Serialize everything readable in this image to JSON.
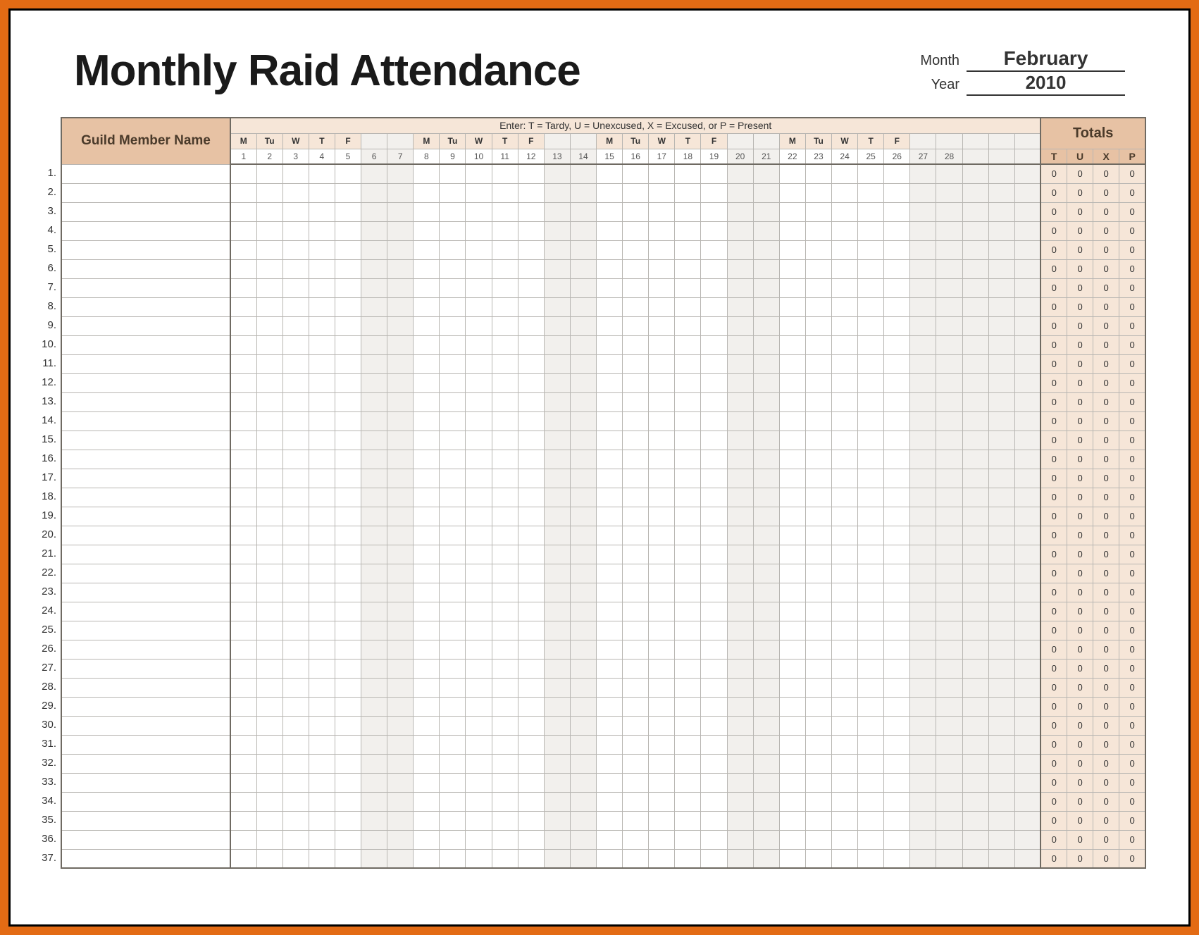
{
  "title": "Monthly Raid Attendance",
  "month_label": "Month",
  "year_label": "Year",
  "month": "February",
  "year": "2010",
  "legend": "Enter: T = Tardy,  U = Unexcused,  X = Excused,  or P = Present",
  "name_header": "Guild Member Name",
  "totals_header": "Totals",
  "total_codes": [
    "T",
    "U",
    "X",
    "P"
  ],
  "num_rows": 37,
  "num_day_columns": 31,
  "days_in_month": 28,
  "days": [
    {
      "n": 1,
      "dow": "M",
      "weekend": false
    },
    {
      "n": 2,
      "dow": "Tu",
      "weekend": false
    },
    {
      "n": 3,
      "dow": "W",
      "weekend": false
    },
    {
      "n": 4,
      "dow": "T",
      "weekend": false
    },
    {
      "n": 5,
      "dow": "F",
      "weekend": false
    },
    {
      "n": 6,
      "dow": "",
      "weekend": true
    },
    {
      "n": 7,
      "dow": "",
      "weekend": true
    },
    {
      "n": 8,
      "dow": "M",
      "weekend": false
    },
    {
      "n": 9,
      "dow": "Tu",
      "weekend": false
    },
    {
      "n": 10,
      "dow": "W",
      "weekend": false
    },
    {
      "n": 11,
      "dow": "T",
      "weekend": false
    },
    {
      "n": 12,
      "dow": "F",
      "weekend": false
    },
    {
      "n": 13,
      "dow": "",
      "weekend": true
    },
    {
      "n": 14,
      "dow": "",
      "weekend": true
    },
    {
      "n": 15,
      "dow": "M",
      "weekend": false
    },
    {
      "n": 16,
      "dow": "Tu",
      "weekend": false
    },
    {
      "n": 17,
      "dow": "W",
      "weekend": false
    },
    {
      "n": 18,
      "dow": "T",
      "weekend": false
    },
    {
      "n": 19,
      "dow": "F",
      "weekend": false
    },
    {
      "n": 20,
      "dow": "",
      "weekend": true
    },
    {
      "n": 21,
      "dow": "",
      "weekend": true
    },
    {
      "n": 22,
      "dow": "M",
      "weekend": false
    },
    {
      "n": 23,
      "dow": "Tu",
      "weekend": false
    },
    {
      "n": 24,
      "dow": "W",
      "weekend": false
    },
    {
      "n": 25,
      "dow": "T",
      "weekend": false
    },
    {
      "n": 26,
      "dow": "F",
      "weekend": false
    },
    {
      "n": 27,
      "dow": "",
      "weekend": true
    },
    {
      "n": 28,
      "dow": "",
      "weekend": true
    }
  ],
  "rows": [
    {
      "name": "",
      "marks": [],
      "totals": [
        0,
        0,
        0,
        0
      ]
    },
    {
      "name": "",
      "marks": [],
      "totals": [
        0,
        0,
        0,
        0
      ]
    },
    {
      "name": "",
      "marks": [],
      "totals": [
        0,
        0,
        0,
        0
      ]
    },
    {
      "name": "",
      "marks": [],
      "totals": [
        0,
        0,
        0,
        0
      ]
    },
    {
      "name": "",
      "marks": [],
      "totals": [
        0,
        0,
        0,
        0
      ]
    },
    {
      "name": "",
      "marks": [],
      "totals": [
        0,
        0,
        0,
        0
      ]
    },
    {
      "name": "",
      "marks": [],
      "totals": [
        0,
        0,
        0,
        0
      ]
    },
    {
      "name": "",
      "marks": [],
      "totals": [
        0,
        0,
        0,
        0
      ]
    },
    {
      "name": "",
      "marks": [],
      "totals": [
        0,
        0,
        0,
        0
      ]
    },
    {
      "name": "",
      "marks": [],
      "totals": [
        0,
        0,
        0,
        0
      ]
    },
    {
      "name": "",
      "marks": [],
      "totals": [
        0,
        0,
        0,
        0
      ]
    },
    {
      "name": "",
      "marks": [],
      "totals": [
        0,
        0,
        0,
        0
      ]
    },
    {
      "name": "",
      "marks": [],
      "totals": [
        0,
        0,
        0,
        0
      ]
    },
    {
      "name": "",
      "marks": [],
      "totals": [
        0,
        0,
        0,
        0
      ]
    },
    {
      "name": "",
      "marks": [],
      "totals": [
        0,
        0,
        0,
        0
      ]
    },
    {
      "name": "",
      "marks": [],
      "totals": [
        0,
        0,
        0,
        0
      ]
    },
    {
      "name": "",
      "marks": [],
      "totals": [
        0,
        0,
        0,
        0
      ]
    },
    {
      "name": "",
      "marks": [],
      "totals": [
        0,
        0,
        0,
        0
      ]
    },
    {
      "name": "",
      "marks": [],
      "totals": [
        0,
        0,
        0,
        0
      ]
    },
    {
      "name": "",
      "marks": [],
      "totals": [
        0,
        0,
        0,
        0
      ]
    },
    {
      "name": "",
      "marks": [],
      "totals": [
        0,
        0,
        0,
        0
      ]
    },
    {
      "name": "",
      "marks": [],
      "totals": [
        0,
        0,
        0,
        0
      ]
    },
    {
      "name": "",
      "marks": [],
      "totals": [
        0,
        0,
        0,
        0
      ]
    },
    {
      "name": "",
      "marks": [],
      "totals": [
        0,
        0,
        0,
        0
      ]
    },
    {
      "name": "",
      "marks": [],
      "totals": [
        0,
        0,
        0,
        0
      ]
    },
    {
      "name": "",
      "marks": [],
      "totals": [
        0,
        0,
        0,
        0
      ]
    },
    {
      "name": "",
      "marks": [],
      "totals": [
        0,
        0,
        0,
        0
      ]
    },
    {
      "name": "",
      "marks": [],
      "totals": [
        0,
        0,
        0,
        0
      ]
    },
    {
      "name": "",
      "marks": [],
      "totals": [
        0,
        0,
        0,
        0
      ]
    },
    {
      "name": "",
      "marks": [],
      "totals": [
        0,
        0,
        0,
        0
      ]
    },
    {
      "name": "",
      "marks": [],
      "totals": [
        0,
        0,
        0,
        0
      ]
    },
    {
      "name": "",
      "marks": [],
      "totals": [
        0,
        0,
        0,
        0
      ]
    },
    {
      "name": "",
      "marks": [],
      "totals": [
        0,
        0,
        0,
        0
      ]
    },
    {
      "name": "",
      "marks": [],
      "totals": [
        0,
        0,
        0,
        0
      ]
    },
    {
      "name": "",
      "marks": [],
      "totals": [
        0,
        0,
        0,
        0
      ]
    },
    {
      "name": "",
      "marks": [],
      "totals": [
        0,
        0,
        0,
        0
      ]
    },
    {
      "name": "",
      "marks": [],
      "totals": [
        0,
        0,
        0,
        0
      ]
    }
  ]
}
